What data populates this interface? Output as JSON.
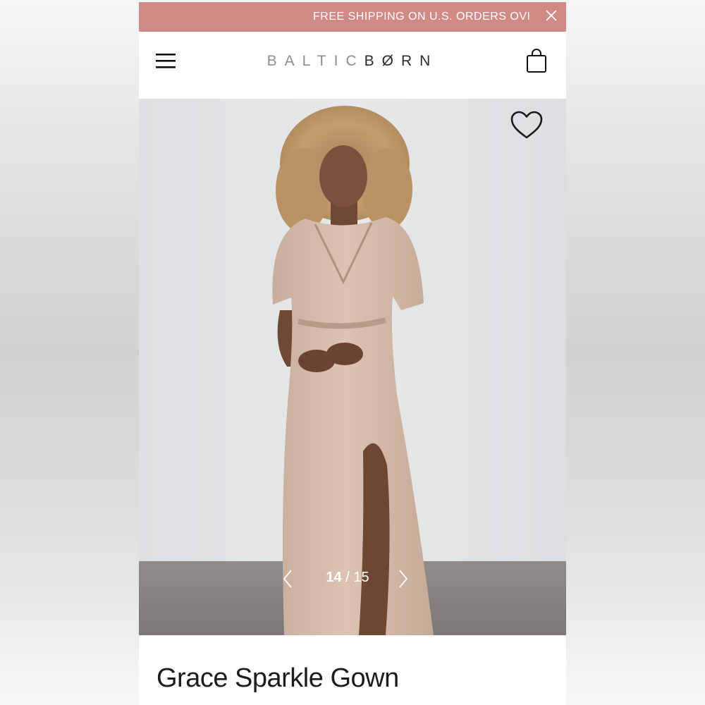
{
  "promo": {
    "text": "FREE SHIPPING ON U.S. ORDERS OVI",
    "close_icon": "close-icon",
    "color": "#d08a86"
  },
  "header": {
    "menu_icon": "hamburger-menu-icon",
    "logo": {
      "part1": "BALTIC",
      "part2": "BØRN"
    },
    "bag_icon": "shopping-bag-icon"
  },
  "gallery": {
    "wishlist_icon": "heart-icon",
    "current": "14",
    "separator": " / ",
    "total": "15",
    "prev_icon": "chevron-left-icon",
    "next_icon": "chevron-right-icon"
  },
  "product": {
    "title": "Grace Sparkle Gown"
  }
}
